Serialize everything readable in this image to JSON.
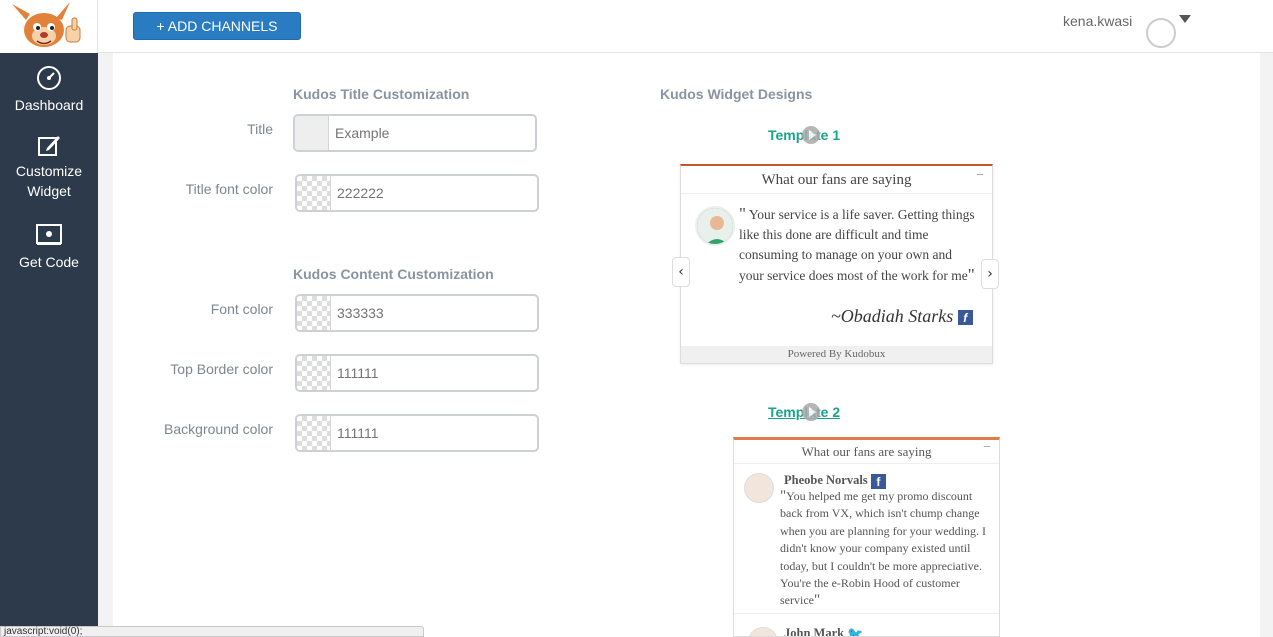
{
  "header": {
    "add_channels_label": "+ ADD CHANNELS",
    "username": "kena.kwasi"
  },
  "sidebar": {
    "items": [
      {
        "label": "Dashboard",
        "icon": "dashboard-icon"
      },
      {
        "label": "Customize Widget",
        "icon": "edit-icon"
      },
      {
        "label": "Get Code",
        "icon": "code-screen-icon"
      }
    ]
  },
  "title_section": {
    "heading": "Kudos Title Customization",
    "title_label": "Title",
    "title_placeholder": "Example",
    "title_font_color_label": "Title font color",
    "title_font_color_value": "222222"
  },
  "content_section": {
    "heading": "Kudos Content Customization",
    "font_color_label": "Font color",
    "font_color_value": "333333",
    "top_border_label": "Top Border color",
    "top_border_value": "111111",
    "background_label": "Background color",
    "background_value": "111111"
  },
  "designs": {
    "heading": "Kudos Widget Designs",
    "template1": {
      "link_label": "Template 1",
      "header": "What our fans are saying",
      "quote": "Your service is a life saver. Getting things like this done are difficult and time consuming to manage on your own and your service does most of the work for me",
      "signature": "~Obadiah Starks",
      "footer": "Powered By Kudobux",
      "accent_color": "#c8542b"
    },
    "template2": {
      "link_label": "Template 2",
      "header": "What our fans are saying",
      "reviewer1_name": "Pheobe Norvals",
      "reviewer1_quote": "You helped me get my promo discount back from VX, which isn't chump change when you are planning for your wedding. I didn't know your company existed until today, but I couldn't be more appreciative. You're the e-Robin Hood of customer service",
      "reviewer2_name": "John Mark",
      "accent_color": "#e07b4a"
    }
  },
  "status_bar": {
    "text": "javascript:void(0);"
  },
  "colors": {
    "sidebar_bg": "#2d3a4b",
    "button_blue": "#2a7cc2",
    "template_link": "#1aa38c"
  }
}
